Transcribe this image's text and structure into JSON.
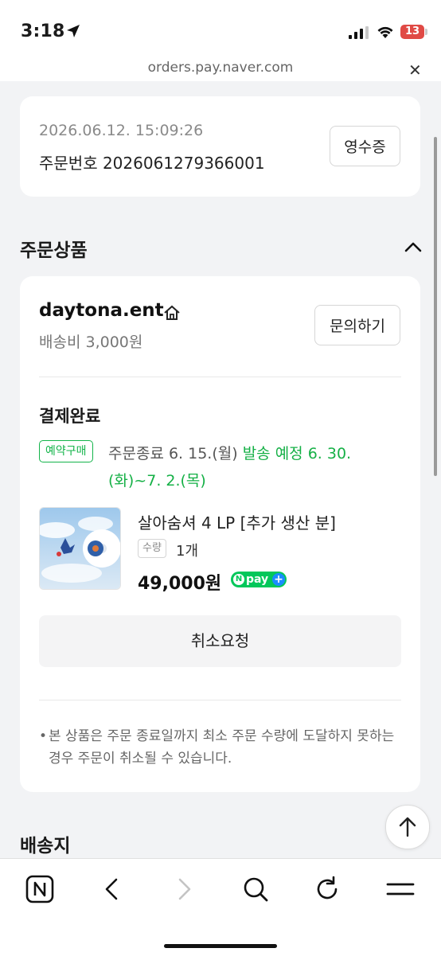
{
  "status_bar": {
    "time": "3:18",
    "battery": "13",
    "icons": [
      "location-arrow-icon",
      "signal-icon",
      "wifi-icon",
      "battery-icon"
    ]
  },
  "browser": {
    "url": "orders.pay.naver.com",
    "close_label": "✕"
  },
  "order": {
    "datetime": "2026.06.12. 15:09:26",
    "order_number": "주문번호 2026061279366001",
    "receipt_label": "영수증"
  },
  "products_section": {
    "title": "주문상품"
  },
  "store": {
    "name": "daytona.ent",
    "shipping_fee": "배송비 3,000원",
    "inquiry_label": "문의하기"
  },
  "item": {
    "status": "결제완료",
    "badge": "예약구매",
    "order_end": "주문종료 6. 15.(월)",
    "ship_schedule_part1": "발송 예정 6. 30.",
    "ship_schedule_part2": "(화)~7. 2.(목)",
    "product_name": "살아숨셔 4 LP [추가 생산 분]",
    "qty_label": "수량",
    "qty_value": "1개",
    "price": "49,000원",
    "npay_text": "pay",
    "cancel_label": "취소요청",
    "notice_line1": "본 상품은 주문 종료일까지 최소 주문 수량에 도달하지 못하는",
    "notice_line2": "경우 주문이 취소될 수 있습니다."
  },
  "delivery_section": {
    "title": "배송지"
  },
  "colors": {
    "accent_green": "#15b046",
    "npay_green": "#03c75a",
    "background": "#f2f3f5"
  },
  "toolbar_icons": [
    "naver-n-icon",
    "back-icon",
    "forward-icon",
    "search-icon",
    "refresh-icon",
    "menu-icon"
  ]
}
